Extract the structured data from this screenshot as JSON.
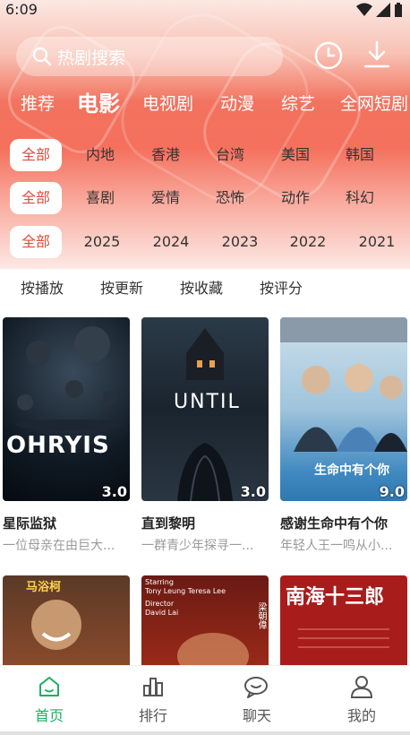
{
  "status": {
    "time": "6:09"
  },
  "search": {
    "placeholder": "热剧搜索"
  },
  "tabs": [
    "推荐",
    "电影",
    "电视剧",
    "动漫",
    "综艺",
    "全网短剧"
  ],
  "filters": {
    "region": [
      "全部",
      "内地",
      "香港",
      "台湾",
      "美国",
      "韩国"
    ],
    "genre": [
      "全部",
      "喜剧",
      "爱情",
      "恐怖",
      "动作",
      "科幻"
    ],
    "year": [
      "全部",
      "2025",
      "2024",
      "2023",
      "2022",
      "2021"
    ]
  },
  "sort": [
    "按播放",
    "按更新",
    "按收藏",
    "按评分"
  ],
  "movies": [
    {
      "title": "星际监狱",
      "desc": "一位母亲在由巨大...",
      "score": "3.0",
      "poster_text": "OHRYIS"
    },
    {
      "title": "直到黎明",
      "desc": "一群青少年探寻一...",
      "score": "3.0",
      "poster_text": "UNTIL"
    },
    {
      "title": "感谢生命中有个你",
      "desc": "年轻人王一鸣从小...",
      "score": "9.0",
      "poster_text": "生命中有个你"
    },
    {
      "title": "",
      "desc": "",
      "score": "",
      "poster_text": "马浴柯"
    },
    {
      "title": "",
      "desc": "",
      "score": "",
      "poster_text": "梁朝偉"
    },
    {
      "title": "",
      "desc": "",
      "score": "",
      "poster_text": "南海十三郎"
    }
  ],
  "nav": [
    "首页",
    "排行",
    "聊天",
    "我的"
  ],
  "colors": {
    "accent": "#e24b3b",
    "nav_active": "#1dae61"
  }
}
